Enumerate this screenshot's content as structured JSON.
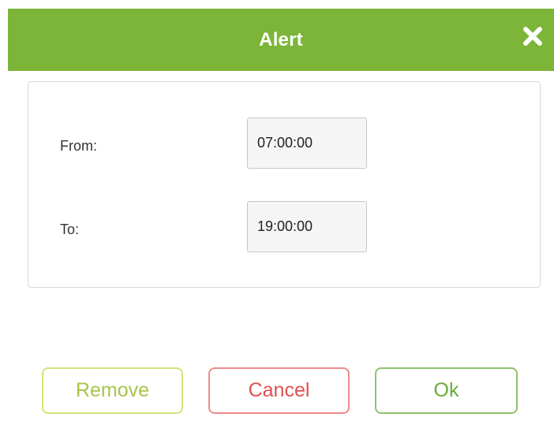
{
  "dialog": {
    "title": "Alert",
    "close_icon": "close-icon",
    "accent_color": "#7cb538"
  },
  "form": {
    "from_label": "From:",
    "from_value": "07:00:00",
    "to_label": "To:",
    "to_value": "19:00:00"
  },
  "buttons": {
    "remove_label": "Remove",
    "remove_color": "#a9c44a",
    "cancel_label": "Cancel",
    "cancel_color": "#e05050",
    "ok_label": "Ok",
    "ok_color": "#6aab37"
  }
}
